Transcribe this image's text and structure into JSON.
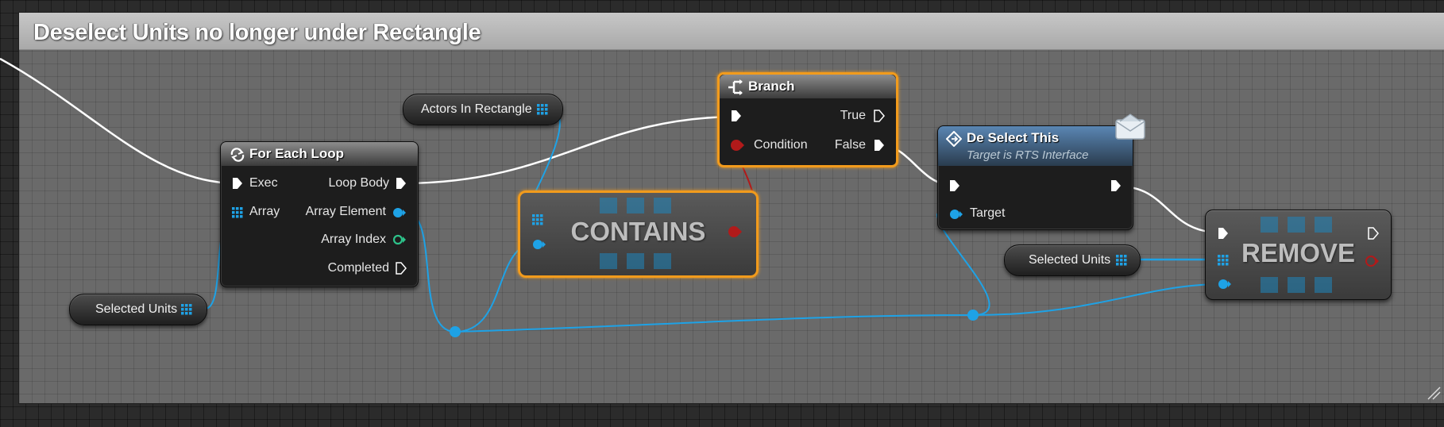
{
  "comment": {
    "title": "Deselect Units no longer under Rectangle"
  },
  "nodes": {
    "for_each_loop": {
      "title": "For Each Loop",
      "icon": "loop-icon",
      "pins": {
        "exec": "Exec",
        "array": "Array",
        "loop_body": "Loop Body",
        "array_element": "Array Element",
        "array_index": "Array Index",
        "completed": "Completed"
      }
    },
    "branch": {
      "title": "Branch",
      "icon": "branch-icon",
      "pins": {
        "true": "True",
        "condition": "Condition",
        "false": "False"
      }
    },
    "deselect_this": {
      "title": "De Select This",
      "subtitle": "Target is RTS Interface",
      "icon": "function-icon",
      "badge_icon": "envelope-icon",
      "pins": {
        "target": "Target"
      }
    },
    "contains": {
      "label": "CONTAINS"
    },
    "remove": {
      "label": "REMOVE"
    }
  },
  "variables": {
    "actors_in_rectangle": "Actors In Rectangle",
    "selected_units_left": "Selected Units",
    "selected_units_right": "Selected Units"
  },
  "colors": {
    "exec_wire": "#ffffff",
    "object_wire": "#1ea2e6",
    "bool_wire": "#b11a1a",
    "selection": "#f29b1c",
    "int_pin": "#2dc28a"
  }
}
